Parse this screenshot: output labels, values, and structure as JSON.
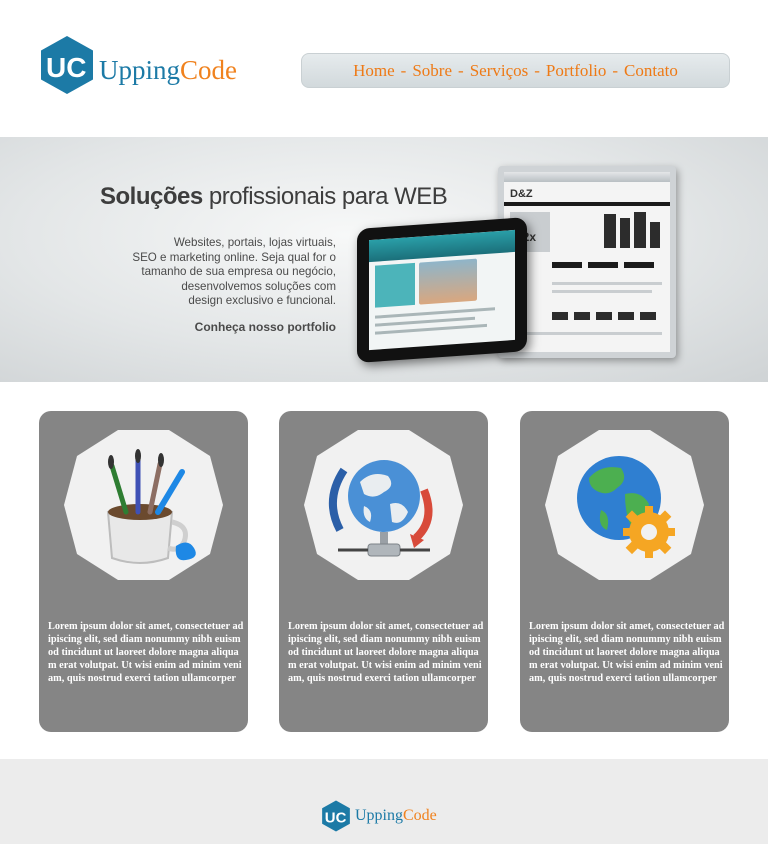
{
  "brand": {
    "part1": "Upping",
    "part2": "Code",
    "mark_letters": "UC",
    "colors": {
      "blue": "#1c7aa6",
      "orange": "#f0821e"
    }
  },
  "nav": {
    "items": [
      "Home",
      "Sobre",
      "Serviços",
      "Portfolio",
      "Contato"
    ],
    "separator": "-"
  },
  "banner": {
    "title_bold": "Soluções",
    "title_rest": " profissionais para WEB",
    "description": "Websites, portais, lojas virtuais,\nSEO e marketing online. Seja qual for o\ntamanho de sua empresa ou negócio,\ndesenvolvemos soluções com\ndesign exclusivo e funcional.",
    "link": "Conheça nosso portfolio",
    "monitor": {
      "site_logo": "D&Z",
      "price": "12x"
    }
  },
  "cards": [
    {
      "icon": "paint-brushes-icon",
      "text": "Lorem ipsum dolor sit amet, consectetuer adipiscing elit, sed diam nonummy nibh euismod tincidunt ut laoreet dolore magna aliquam erat volutpat. Ut wisi enim ad minim veniam, quis nostrud exerci tation ullamcorper"
    },
    {
      "icon": "globe-network-icon",
      "text": "Lorem ipsum dolor sit amet, consectetuer adipiscing elit, sed diam nonummy nibh euismod tincidunt ut laoreet dolore magna aliquam erat volutpat. Ut wisi enim ad minim veniam, quis nostrud exerci tation ullamcorper"
    },
    {
      "icon": "globe-gear-icon",
      "text": "Lorem ipsum dolor sit amet, consectetuer adipiscing elit, sed diam nonummy nibh euismod tincidunt ut laoreet dolore magna aliquam erat volutpat. Ut wisi enim ad minim veniam, quis nostrud exerci tation ullamcorper"
    }
  ],
  "footer": {
    "brand_part1": "Upping",
    "brand_part2": "Code"
  }
}
